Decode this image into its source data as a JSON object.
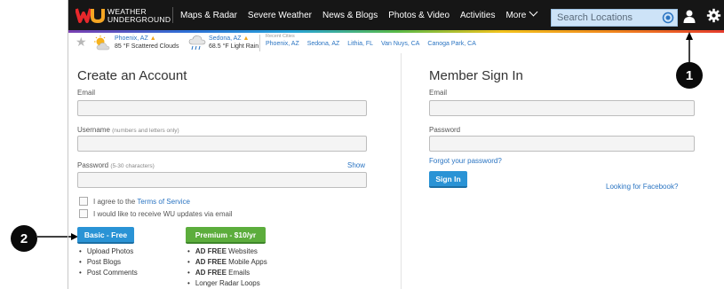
{
  "logo": {
    "line1": "WEATHER",
    "line2": "UNDERGROUND"
  },
  "nav": {
    "items": [
      "Maps & Radar",
      "Severe Weather",
      "News & Blogs",
      "Photos & Video",
      "Activities",
      "More"
    ],
    "search_placeholder": "Search Locations"
  },
  "conditions": [
    {
      "city": "Phoenix, AZ",
      "detail": "85 °F Scattered Clouds"
    },
    {
      "city": "Sedona, AZ",
      "detail": "68.5 °F Light Rain"
    }
  ],
  "recent": {
    "label": "Recent Cities",
    "cities": [
      "Phoenix, AZ",
      "Sedona, AZ",
      "Lithia, FL",
      "Van Nuys, CA",
      "Canoga Park, CA"
    ]
  },
  "create": {
    "title": "Create an Account",
    "email_label": "Email",
    "username_label": "Username",
    "username_hint": "(numbers and letters only)",
    "password_label": "Password",
    "password_hint": "(5-30 characters)",
    "show_label": "Show",
    "terms_prefix": "I agree to the",
    "terms_link": "Terms of Service",
    "updates_label": "I would like to receive WU updates via email",
    "basic_button": "Basic - Free",
    "premium_button": "Premium - $10/yr",
    "basic_features": [
      "Upload Photos",
      "Post Blogs",
      "Post Comments"
    ],
    "premium_features": [
      {
        "bold": "AD FREE",
        "rest": " Websites"
      },
      {
        "bold": "AD FREE",
        "rest": " Mobile Apps"
      },
      {
        "bold": "AD FREE",
        "rest": " Emails"
      },
      {
        "bold": "",
        "rest": "Longer Radar Loops"
      }
    ]
  },
  "signin": {
    "title": "Member Sign In",
    "email_label": "Email",
    "password_label": "Password",
    "forgot_link": "Forgot your password?",
    "signin_button": "Sign In",
    "facebook_link": "Looking for Facebook?"
  },
  "callouts": [
    "1",
    "2"
  ],
  "colors": {
    "nav_bg": "#161616",
    "link": "#2a74c2",
    "blue_button": "#2a93d5",
    "green_button": "#5cad3c"
  }
}
